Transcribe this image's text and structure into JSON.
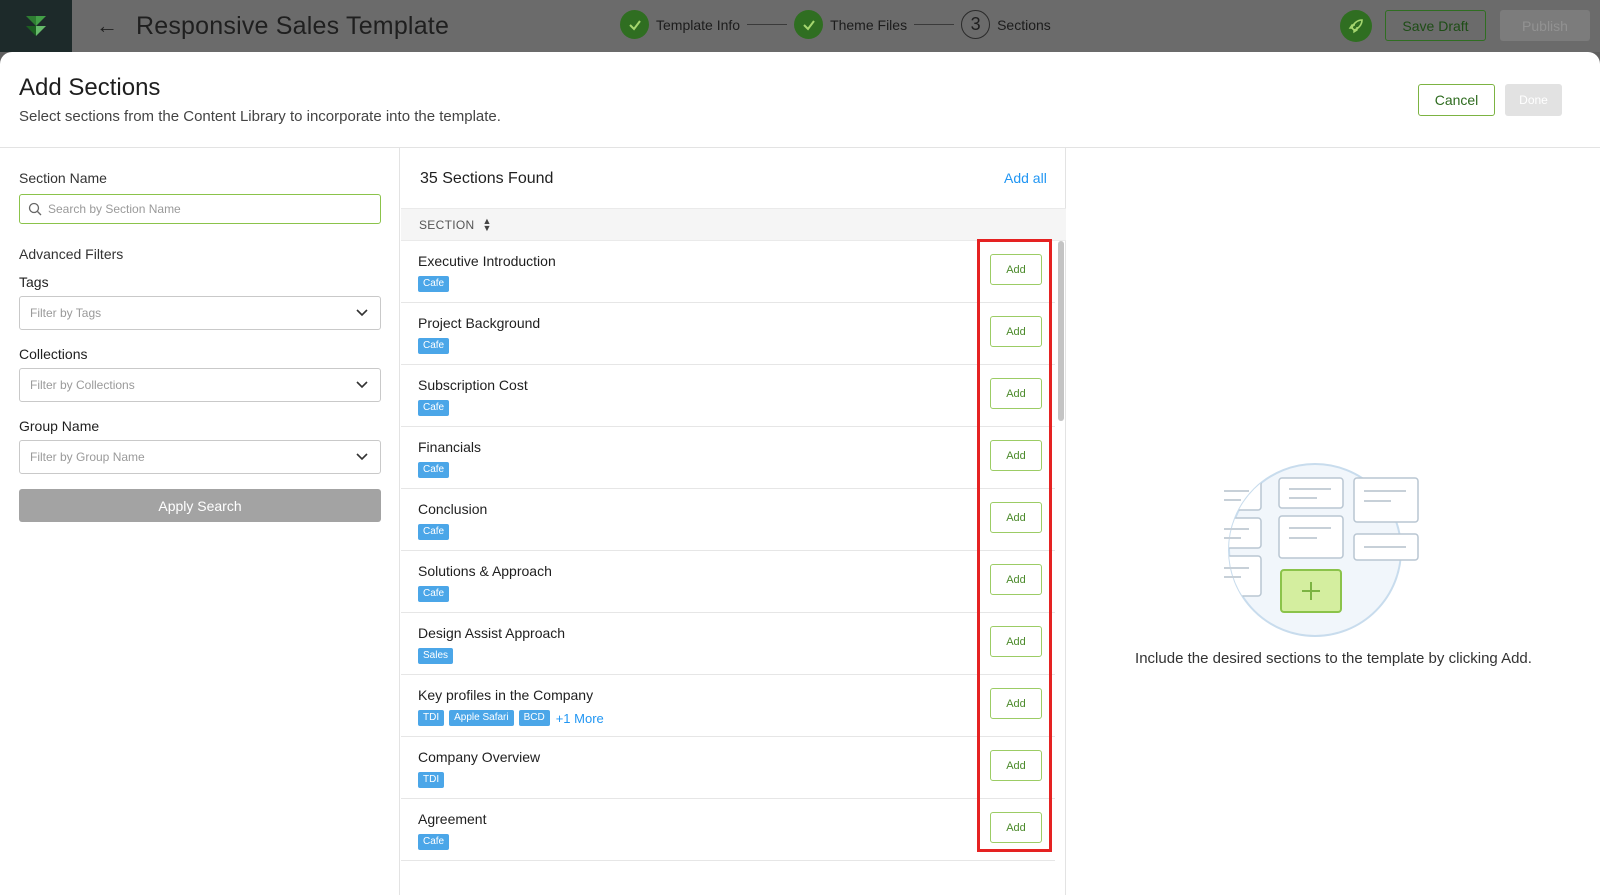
{
  "app": {
    "title": "Responsive Sales Template",
    "steps": [
      {
        "label": "Template Info",
        "status": "done"
      },
      {
        "label": "Theme Files",
        "status": "done"
      },
      {
        "number": "3",
        "label": "Sections",
        "status": "current"
      }
    ],
    "save_draft": "Save Draft",
    "publish": "Publish"
  },
  "modal": {
    "title": "Add Sections",
    "subtitle": "Select sections from the Content Library to incorporate into the template.",
    "cancel": "Cancel",
    "done": "Done"
  },
  "filters": {
    "section_name_label": "Section Name",
    "search_placeholder": "Search by Section Name",
    "advanced_label": "Advanced Filters",
    "tags_label": "Tags",
    "tags_placeholder": "Filter by Tags",
    "collections_label": "Collections",
    "collections_placeholder": "Filter by Collections",
    "group_label": "Group Name",
    "group_placeholder": "Filter by Group Name",
    "apply": "Apply Search"
  },
  "list": {
    "found": "35 Sections Found",
    "add_all": "Add all",
    "column": "SECTION",
    "add_label": "Add",
    "rows": [
      {
        "title": "Executive Introduction",
        "tags": [
          "Cafe"
        ]
      },
      {
        "title": "Project Background",
        "tags": [
          "Cafe"
        ]
      },
      {
        "title": "Subscription Cost",
        "tags": [
          "Cafe"
        ]
      },
      {
        "title": "Financials",
        "tags": [
          "Cafe"
        ]
      },
      {
        "title": "Conclusion",
        "tags": [
          "Cafe"
        ]
      },
      {
        "title": "Solutions & Approach",
        "tags": [
          "Cafe"
        ]
      },
      {
        "title": "Design Assist Approach",
        "tags": [
          "Sales"
        ]
      },
      {
        "title": "Key profiles in the Company",
        "tags": [
          "TDI",
          "Apple Safari",
          "BCD"
        ],
        "more": "+1 More"
      },
      {
        "title": "Company Overview",
        "tags": [
          "TDI"
        ]
      },
      {
        "title": "Agreement",
        "tags": [
          "Cafe"
        ]
      }
    ]
  },
  "empty_state": {
    "text": "Include the desired sections to the template by clicking Add."
  },
  "colors": {
    "brand_green": "#2f6e21",
    "accent_green": "#8bc34a",
    "tag_blue": "#4ba6e8",
    "link_blue": "#2196f3",
    "highlight_red": "#e52222"
  }
}
